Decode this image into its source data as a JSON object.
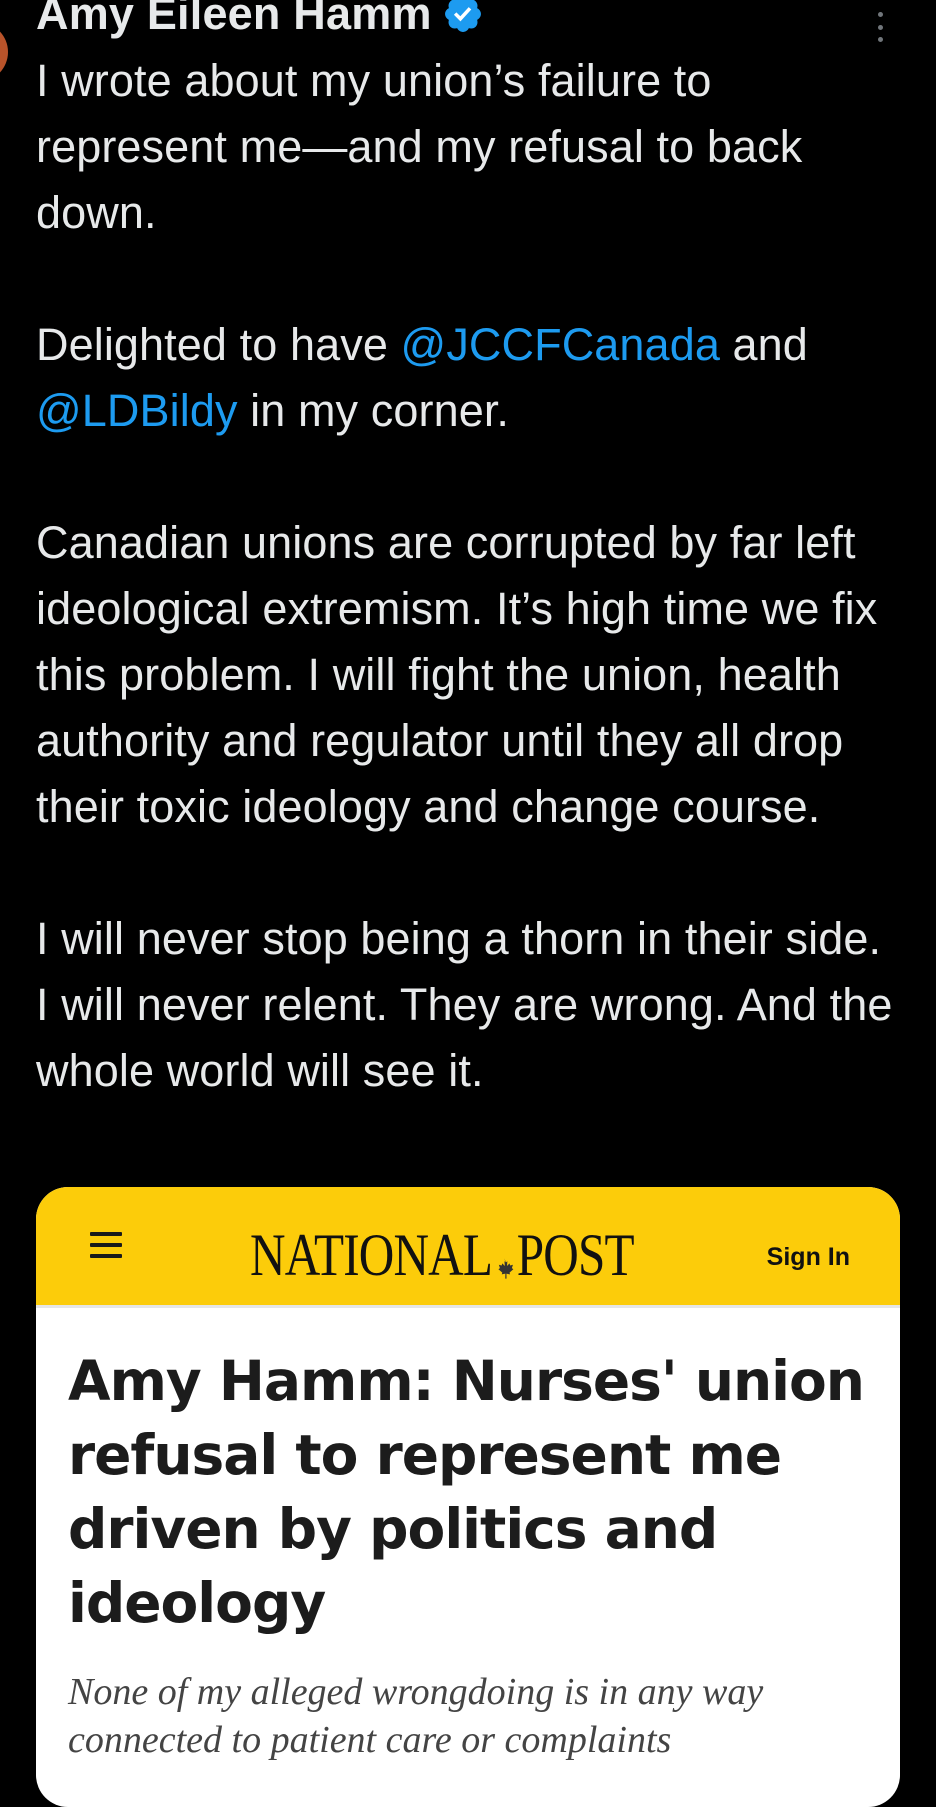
{
  "tweet": {
    "author_name": "Amy Eileen Hamm",
    "verified_icon": "verified-badge-icon",
    "more_icon": "more-options-icon",
    "paragraphs": {
      "p1": "I wrote about my union’s failure to represent me—and my refusal to back down.",
      "p2_pre": "Delighted to have ",
      "p2_mention1": "@JCCFCanada",
      "p2_mid": " and ",
      "p2_mention2": "@LDBildy",
      "p2_post": " in my corner.",
      "p3": "Canadian unions are corrupted by far left ideological extremism. It’s high time we fix this problem. I will fight the union, health authority and regulator until they all drop their toxic ideology and change course.",
      "p4": "I will never stop being a thorn in their side. I will never relent. They are wrong. And the whole world will see it."
    }
  },
  "link_card": {
    "menu_icon": "hamburger-menu-icon",
    "logo_left": "NATIONAL",
    "logo_right": "POST",
    "logo_icon": "maple-leaf-icon",
    "sign_in_label": "Sign In",
    "headline": "Amy Hamm: Nurses' union refusal to represent me driven by politics and ideology",
    "subheadline": "None of my alleged wrongdoing is in any way connected to patient care or complaints"
  },
  "colors": {
    "background": "#000000",
    "text": "#e7e9ea",
    "mention": "#1d9bf0",
    "verified": "#1d9bf0",
    "card_header": "#fccc0a",
    "card_body": "#ffffff"
  }
}
